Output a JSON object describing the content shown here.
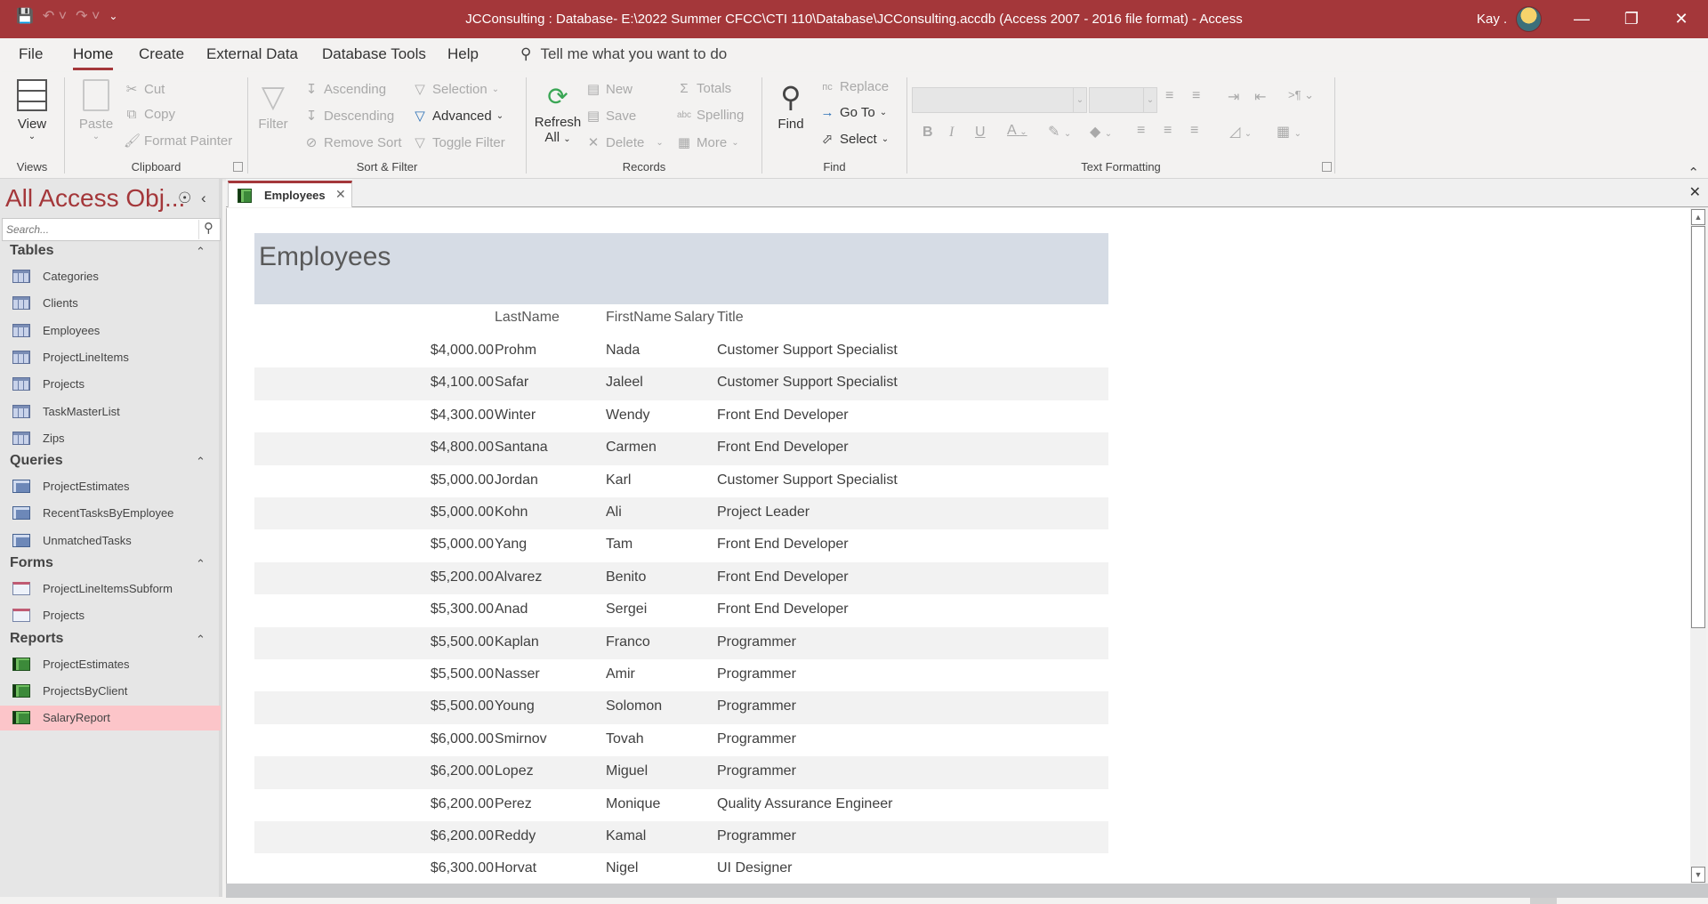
{
  "titlebar": {
    "title": "JCConsulting : Database- E:\\2022 Summer CFCC\\CTI 110\\Database\\JCConsulting.accdb (Access 2007 - 2016 file format)  -  Access",
    "user": "Kay .",
    "qat": {
      "save": "save-icon",
      "undo": "undo-icon",
      "redo": "redo-icon",
      "customize": "customize-qat-icon"
    },
    "window_buttons": {
      "minimize": "—",
      "restore": "❐",
      "close": "✕"
    }
  },
  "menu_tabs": [
    {
      "label": "File",
      "active": false
    },
    {
      "label": "Home",
      "active": true
    },
    {
      "label": "Create",
      "active": false
    },
    {
      "label": "External Data",
      "active": false
    },
    {
      "label": "Database Tools",
      "active": false
    },
    {
      "label": "Help",
      "active": false
    }
  ],
  "tell_me": {
    "placeholder": "Tell me what you want to do"
  },
  "ribbon": {
    "views": {
      "label": "Views",
      "view_button": "View"
    },
    "clipboard": {
      "label": "Clipboard",
      "paste": "Paste",
      "cut": "Cut",
      "copy": "Copy",
      "format_painter": "Format Painter"
    },
    "sort_filter": {
      "label": "Sort & Filter",
      "filter": "Filter",
      "ascending": "Ascending",
      "descending": "Descending",
      "remove_sort": "Remove Sort",
      "selection": "Selection",
      "advanced": "Advanced",
      "toggle_filter": "Toggle Filter"
    },
    "records": {
      "label": "Records",
      "refresh": "Refresh",
      "refresh_all": "All",
      "new": "New",
      "save": "Save",
      "delete": "Delete",
      "totals": "Totals",
      "spelling": "Spelling",
      "more": "More"
    },
    "find": {
      "label": "Find",
      "find": "Find",
      "replace": "Replace",
      "go_to": "Go To",
      "select": "Select"
    },
    "text_formatting": {
      "label": "Text Formatting",
      "font_value": "",
      "size_value": "",
      "bold": "B",
      "italic": "I",
      "underline": "U"
    }
  },
  "nav": {
    "header": "All Access Obj...",
    "search_placeholder": "Search...",
    "sections": [
      {
        "name": "Tables",
        "items": [
          "Categories",
          "Clients",
          "Employees",
          "ProjectLineItems",
          "Projects",
          "TaskMasterList",
          "Zips"
        ]
      },
      {
        "name": "Queries",
        "items": [
          "ProjectEstimates",
          "RecentTasksByEmployee",
          "UnmatchedTasks"
        ]
      },
      {
        "name": "Forms",
        "items": [
          "ProjectLineItemsSubform",
          "Projects"
        ]
      },
      {
        "name": "Reports",
        "items": [
          "ProjectEstimates",
          "ProjectsByClient",
          "SalaryReport"
        ]
      }
    ],
    "selected": "SalaryReport"
  },
  "document_tab": {
    "label": "Employees"
  },
  "report": {
    "title": "Employees",
    "columns": [
      "Salary",
      "LastName",
      "FirstName",
      "Title"
    ],
    "rows": [
      [
        "$4,000.00",
        "Prohm",
        "Nada",
        "Customer Support Specialist"
      ],
      [
        "$4,100.00",
        "Safar",
        "Jaleel",
        "Customer Support Specialist"
      ],
      [
        "$4,300.00",
        "Winter",
        "Wendy",
        "Front End Developer"
      ],
      [
        "$4,800.00",
        "Santana",
        "Carmen",
        "Front End Developer"
      ],
      [
        "$5,000.00",
        "Jordan",
        "Karl",
        "Customer Support Specialist"
      ],
      [
        "$5,000.00",
        "Kohn",
        "Ali",
        "Project Leader"
      ],
      [
        "$5,000.00",
        "Yang",
        "Tam",
        "Front End Developer"
      ],
      [
        "$5,200.00",
        "Alvarez",
        "Benito",
        "Front End Developer"
      ],
      [
        "$5,300.00",
        "Anad",
        "Sergei",
        "Front End Developer"
      ],
      [
        "$5,500.00",
        "Kaplan",
        "Franco",
        "Programmer"
      ],
      [
        "$5,500.00",
        "Nasser",
        "Amir",
        "Programmer"
      ],
      [
        "$5,500.00",
        "Young",
        "Solomon",
        "Programmer"
      ],
      [
        "$6,000.00",
        "Smirnov",
        "Tovah",
        "Programmer"
      ],
      [
        "$6,200.00",
        "Lopez",
        "Miguel",
        "Programmer"
      ],
      [
        "$6,200.00",
        "Perez",
        "Monique",
        "Quality Assurance Engineer"
      ],
      [
        "$6,200.00",
        "Reddy",
        "Kamal",
        "Programmer"
      ],
      [
        "$6,300.00",
        "Horvat",
        "Nigel",
        "UI Designer"
      ]
    ]
  },
  "colors": {
    "accent": "#a4373a",
    "nav_selected": "#fcc5c9",
    "report_header_band": "#d6dce5",
    "row_alt": "#f2f2f2"
  }
}
